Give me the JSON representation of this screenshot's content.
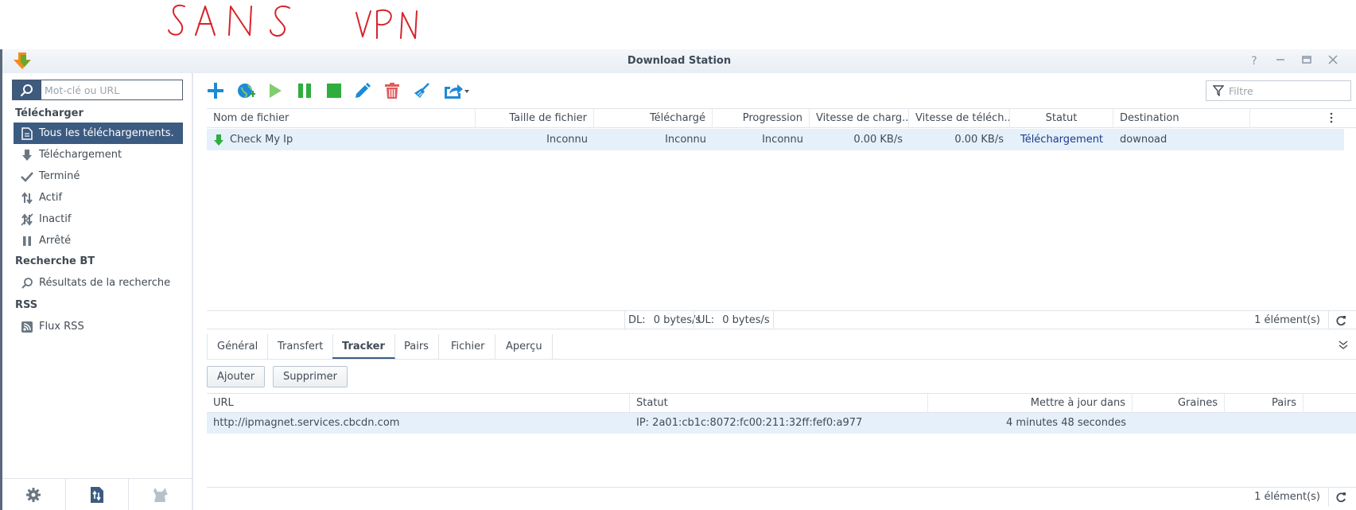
{
  "annotation": {
    "text": "SANS VPN",
    "color": "#d8232a"
  },
  "window": {
    "title": "Download Station"
  },
  "sidebar": {
    "search_placeholder": "Mot-clé ou URL",
    "section_download": "Télécharger",
    "items": [
      {
        "label": "Tous les téléchargements.",
        "icon": "document-icon",
        "active": true
      },
      {
        "label": "Téléchargement",
        "icon": "arrow-down-icon"
      },
      {
        "label": "Terminé",
        "icon": "check-icon"
      },
      {
        "label": "Actif",
        "icon": "up-down-arrows-icon"
      },
      {
        "label": "Inactif",
        "icon": "inactive-icon"
      },
      {
        "label": "Arrêté",
        "icon": "pause-icon"
      }
    ],
    "section_bt": "Recherche BT",
    "bt_item": {
      "label": "Résultats de la recherche",
      "icon": "search-icon"
    },
    "section_rss": "RSS",
    "rss_item": {
      "label": "Flux RSS",
      "icon": "rss-icon"
    }
  },
  "toolbar": {
    "filter_placeholder": "Filtre",
    "buttons": [
      "add-icon",
      "add-url-icon",
      "resume-icon",
      "pause-icon",
      "stop-icon",
      "edit-icon",
      "delete-icon",
      "clear-icon",
      "share-icon"
    ]
  },
  "grid": {
    "columns": [
      "Nom de fichier",
      "Taille de fichier",
      "Téléchargé",
      "Progression",
      "Vitesse de charg...",
      "Vitesse de téléch...",
      "Statut",
      "Destination"
    ],
    "rows": [
      {
        "name": "Check My Ip",
        "size": "Inconnu",
        "downloaded": "Inconnu",
        "progress": "Inconnu",
        "upload_speed": "0.00 KB/s",
        "download_speed": "0.00 KB/s",
        "status": "Téléchargement",
        "destination": "downoad"
      }
    ]
  },
  "status_bar": {
    "dl_label": "DL:",
    "dl_value": "0 bytes/s",
    "ul_label": "UL:",
    "ul_value": "0 bytes/s",
    "count": "1 élément(s)"
  },
  "detail_tabs": [
    "Général",
    "Transfert",
    "Tracker",
    "Pairs",
    "Fichier",
    "Aperçu"
  ],
  "detail_active_tab": "Tracker",
  "tracker": {
    "add_label": "Ajouter",
    "delete_label": "Supprimer",
    "columns": [
      "URL",
      "Statut",
      "Mettre à jour dans",
      "Graines",
      "Pairs"
    ],
    "rows": [
      {
        "url": "http://ipmagnet.services.cbcdn.com",
        "status": "IP: 2a01:cb1c:8072:fc00:211:32ff:fef0:a977",
        "update": "4 minutes 48 secondes",
        "seeds": "",
        "peers": ""
      }
    ],
    "count": "1 élément(s)"
  }
}
